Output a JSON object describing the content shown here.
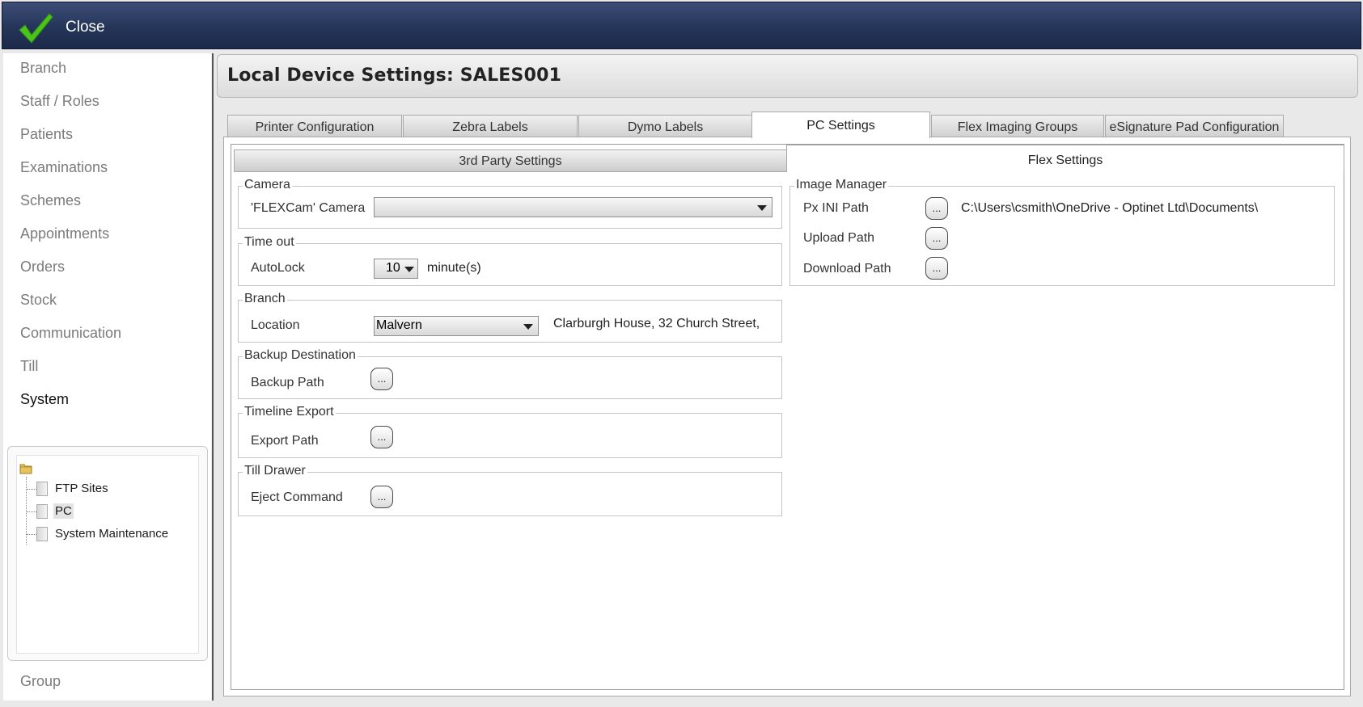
{
  "topbar": {
    "close_label": "Close",
    "icon": "checkmark-icon",
    "accent": "#4cc21d"
  },
  "sidebar": {
    "items": [
      {
        "label": "Branch"
      },
      {
        "label": "Staff / Roles"
      },
      {
        "label": "Patients"
      },
      {
        "label": "Examinations"
      },
      {
        "label": "Schemes"
      },
      {
        "label": "Appointments"
      },
      {
        "label": "Orders"
      },
      {
        "label": "Stock"
      },
      {
        "label": "Communication"
      },
      {
        "label": "Till"
      },
      {
        "label": "System"
      }
    ],
    "active": "System",
    "tree": [
      {
        "label": "FTP Sites"
      },
      {
        "label": "PC"
      },
      {
        "label": "System Maintenance"
      }
    ],
    "selected_tree_item": "PC",
    "bottom_item": "Group"
  },
  "header": {
    "title": "Local Device Settings: SALES001"
  },
  "tabs": [
    {
      "label": "Printer Configuration"
    },
    {
      "label": "Zebra Labels"
    },
    {
      "label": "Dymo Labels"
    },
    {
      "label": "PC Settings"
    },
    {
      "label": "Flex Imaging Groups"
    },
    {
      "label": "eSignature Pad Configuration"
    }
  ],
  "active_tab": "PC Settings",
  "subtabs": [
    {
      "label": "3rd Party Settings"
    },
    {
      "label": "Flex Settings"
    }
  ],
  "active_subtab": "Flex Settings",
  "groups": {
    "camera": {
      "title": "Camera",
      "label": "'FLEXCam' Camera",
      "value": ""
    },
    "timeout": {
      "title": "Time out",
      "label": "AutoLock",
      "value": "10",
      "unit": "minute(s)"
    },
    "branch": {
      "title": "Branch",
      "label": "Location",
      "value": "Malvern",
      "address": "Clarburgh House, 32 Church Street,"
    },
    "backup": {
      "title": "Backup Destination",
      "label": "Backup Path",
      "button": "..."
    },
    "timeline": {
      "title": "Timeline Export",
      "label": "Export Path",
      "button": "..."
    },
    "till": {
      "title": "Till Drawer",
      "label": "Eject Command",
      "button": "..."
    },
    "image_manager": {
      "title": "Image Manager",
      "px_ini_label": "Px INI Path",
      "px_ini_value": "C:\\Users\\csmith\\OneDrive - Optinet Ltd\\Documents\\",
      "upload_label": "Upload Path",
      "download_label": "Download Path",
      "button": "..."
    }
  }
}
